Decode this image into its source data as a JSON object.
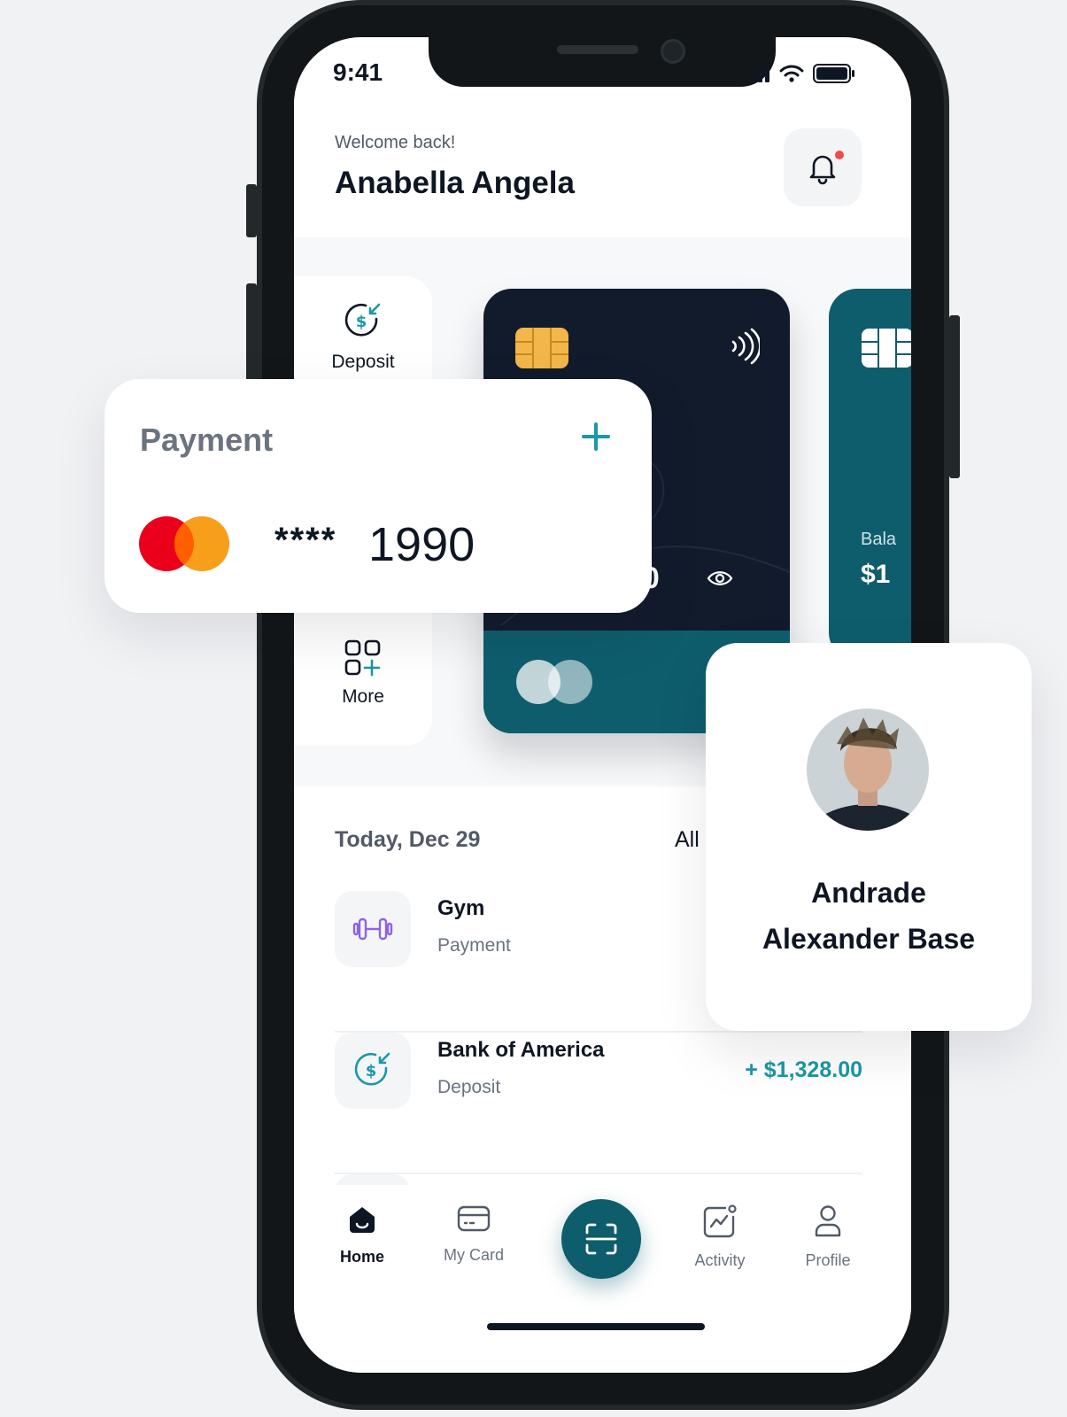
{
  "status_bar": {
    "time": "9:41"
  },
  "header": {
    "welcome": "Welcome back!",
    "user_name": "Anabella Angela"
  },
  "quick_actions": [
    {
      "label": "Deposit",
      "icon": "deposit-icon"
    },
    {
      "label": "More",
      "icon": "more-grid-icon"
    }
  ],
  "card_dark": {
    "amount_partial": "00"
  },
  "card_teal": {
    "balance_label": "Bala",
    "balance_value": "$1"
  },
  "transactions": {
    "date": "Today, Dec 29",
    "filter_label": "All",
    "items": [
      {
        "title": "Gym",
        "subtitle": "Payment",
        "amount": "",
        "icon": "dumbbell-icon"
      },
      {
        "title": "Bank of America",
        "subtitle": "Deposit",
        "amount": "+ $1,328.00",
        "icon": "deposit-icon"
      }
    ]
  },
  "tabbar": {
    "items": [
      {
        "label": "Home",
        "icon": "home-icon",
        "active": true
      },
      {
        "label": "My Card",
        "icon": "card-icon",
        "active": false
      },
      {
        "label": "Activity",
        "icon": "activity-icon",
        "active": false
      },
      {
        "label": "Profile",
        "icon": "profile-icon",
        "active": false
      }
    ],
    "center_icon": "scan-icon"
  },
  "payment_card": {
    "title": "Payment",
    "masked": "****",
    "last4": "1990",
    "brand_icon": "mastercard-icon"
  },
  "contact_card": {
    "name_line1": "Andrade",
    "name_line2": "Alexander Base"
  },
  "colors": {
    "primary_teal": "#0e5d6d",
    "accent_teal": "#1a98a6",
    "dark_card": "#121b2c",
    "notification_red": "#f04a4a"
  }
}
